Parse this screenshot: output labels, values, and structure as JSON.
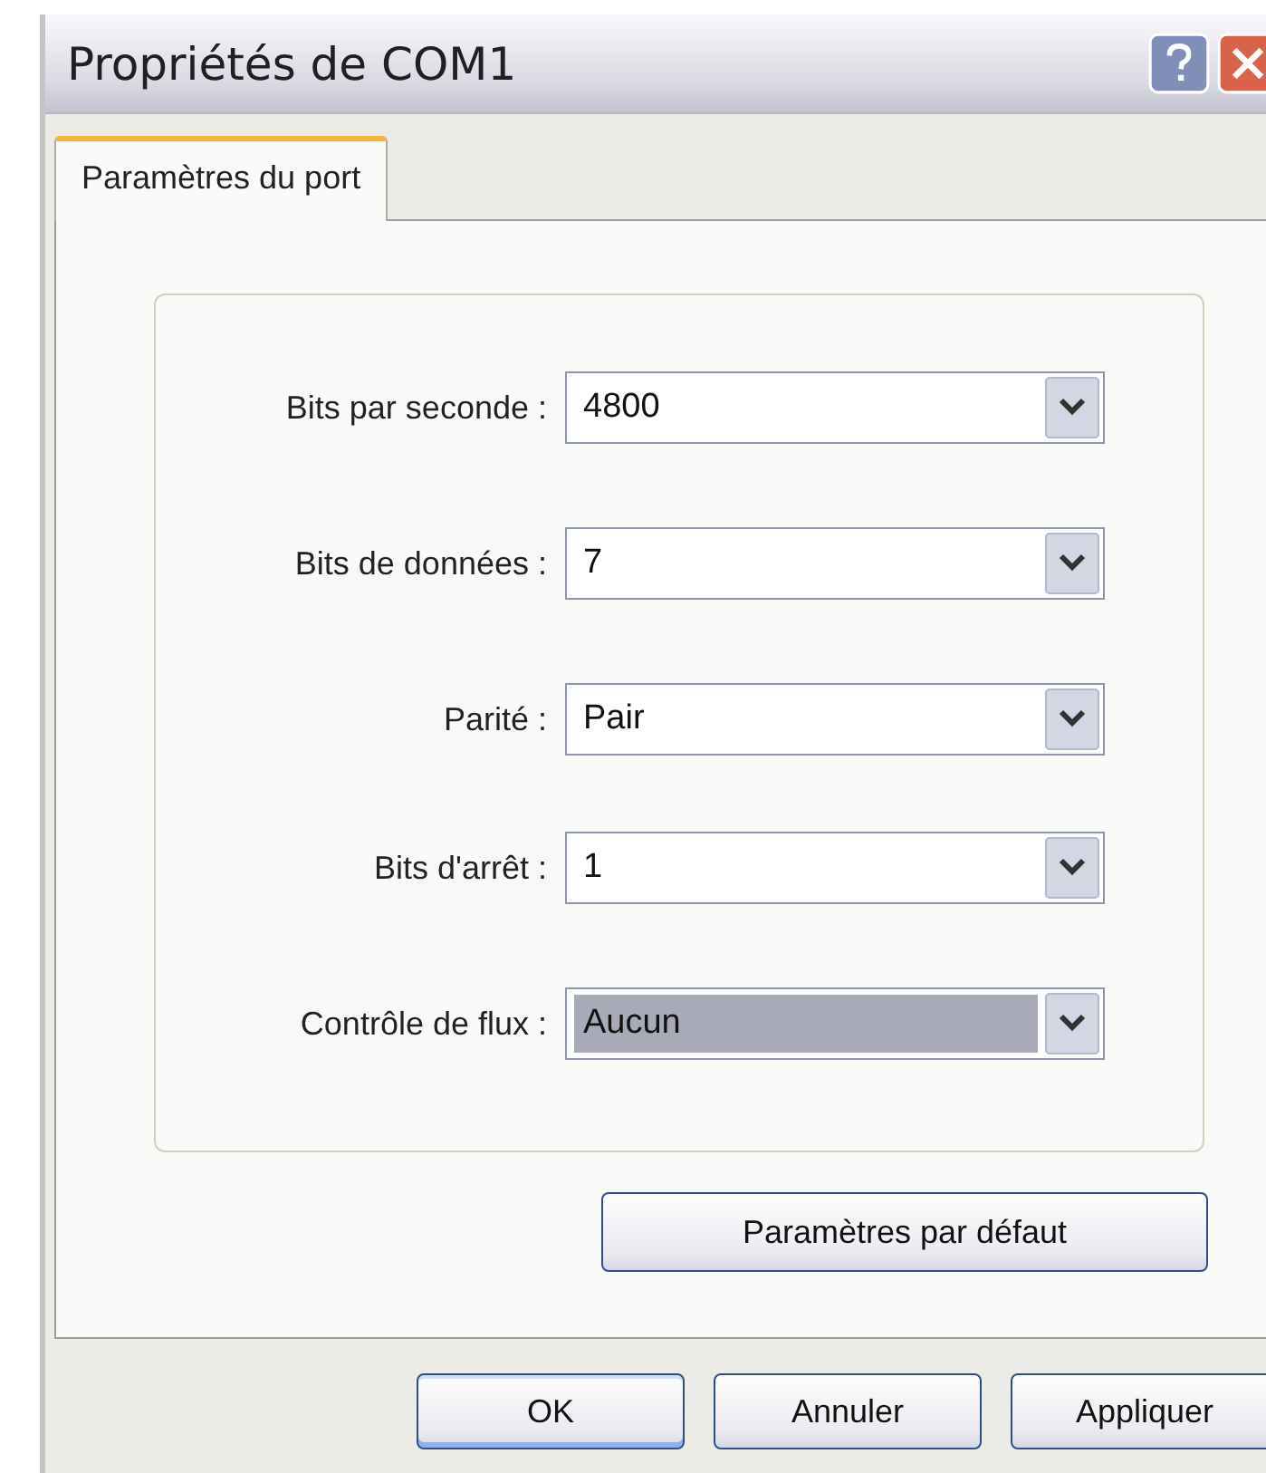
{
  "window": {
    "title": "Propriétés de COM1"
  },
  "tabs": [
    {
      "label": "Paramètres du port",
      "selected": true
    }
  ],
  "fields": [
    {
      "label": "Bits par seconde :",
      "value": "4800",
      "focused": false
    },
    {
      "label": "Bits de données :",
      "value": "7",
      "focused": false
    },
    {
      "label": "Parité :",
      "value": "Pair",
      "focused": false
    },
    {
      "label": "Bits d'arrêt :",
      "value": "1",
      "focused": false
    },
    {
      "label": "Contrôle de flux :",
      "value": "Aucun",
      "focused": true
    }
  ],
  "defaults_button": "Paramètres par défaut",
  "buttons": [
    {
      "label": "OK",
      "default": true
    },
    {
      "label": "Annuler",
      "default": false
    },
    {
      "label": "Appliquer",
      "default": false
    }
  ]
}
